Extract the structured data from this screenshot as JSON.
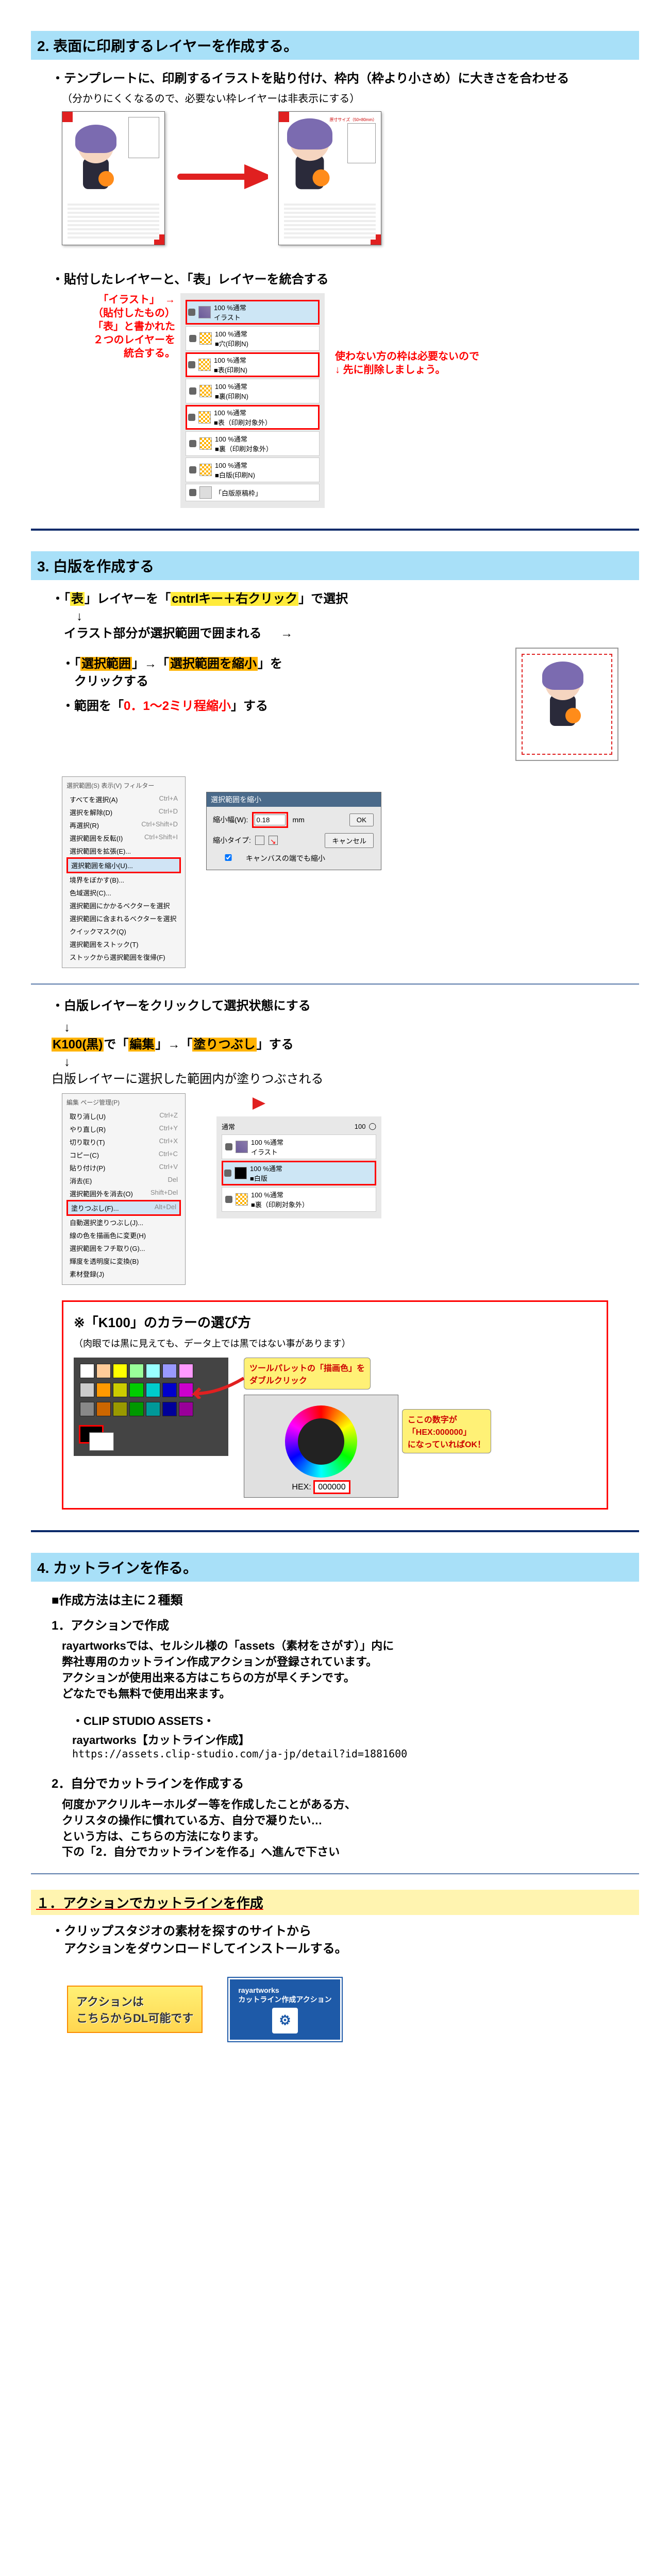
{
  "step2": {
    "header": "2. 表面に印刷するレイヤーを作成する。",
    "bullet1": "・テンプレートに、印刷するイラストを貼り付け、枠内（枠より小さめ）に大きさを合わせる",
    "note1": "（分かりにくくなるので、必要ない枠レイヤーは非表示にする）",
    "bullet2": "・貼付したレイヤーと、「表」レイヤーを統合する",
    "annot_left_1": "「イラスト」",
    "annot_left_2": "（貼付したもの）",
    "annot_left_3": "「表」と書かれた",
    "annot_left_4": "２つのレイヤーを",
    "annot_left_5": "統合する。",
    "annot_right_1": "使わない方の枠は必要ないので",
    "annot_right_2": "先に削除しましょう。",
    "layers": {
      "item1": "100 %通常\nイラスト",
      "item2": "100 %通常\n■穴(印刷N)",
      "item3": "100 %通常\n■表(印刷N)",
      "item4": "100 %通常\n■裏(印刷N)",
      "item5": "100 %通常\n■表（印刷対象外）",
      "item6": "100 %通常\n■裏（印刷対象外）",
      "item7": "100 %通常\n■白版(印刷N)",
      "item8": "「白版原稿枠」"
    }
  },
  "step3": {
    "header": "3. 白版を作成する",
    "bullet1a": "・「",
    "bullet1b": "表",
    "bullet1c": "」レイヤーを「",
    "bullet1d": "cntrlキー＋右クリック",
    "bullet1e": "」で選択",
    "bullet1f": "↓",
    "bullet1g": "イラスト部分が選択範囲で囲まれる",
    "bullet2": "・「",
    "bullet2a": "選択範囲",
    "bullet2b": "」→「",
    "bullet2c": "選択範囲を縮小",
    "bullet2d": "」を",
    "bullet2e": "クリックする",
    "bullet3a": "・範囲を「",
    "bullet3b": "0．1～2ミリ程縮小",
    "bullet3c": "」する",
    "menu": {
      "header": "選択範囲(S)  表示(V)  フィルター",
      "items": [
        {
          "l": "すべてを選択(A)",
          "r": "Ctrl+A"
        },
        {
          "l": "選択を解除(D)",
          "r": "Ctrl+D"
        },
        {
          "l": "再選択(R)",
          "r": "Ctrl+Shift+D"
        },
        {
          "l": "選択範囲を反転(I)",
          "r": "Ctrl+Shift+I"
        },
        {
          "l": "選択範囲を拡張(E)...",
          "r": ""
        },
        {
          "l": "選択範囲を縮小(U)...",
          "r": ""
        },
        {
          "l": "境界をぼかす(B)...",
          "r": ""
        },
        {
          "l": "色域選択(C)...",
          "r": ""
        },
        {
          "l": "選択範囲にかかるベクターを選択",
          "r": ""
        },
        {
          "l": "選択範囲に含まれるベクターを選択",
          "r": ""
        },
        {
          "l": "クイックマスク(Q)",
          "r": ""
        },
        {
          "l": "選択範囲をストック(T)",
          "r": ""
        },
        {
          "l": "ストックから選択範囲を復帰(F)",
          "r": ""
        }
      ]
    },
    "dialog": {
      "title": "選択範囲を縮小",
      "label1": "縮小幅(W):",
      "value1": "0.18",
      "unit1": "mm",
      "label2": "縮小タイプ:",
      "check1": "キャンバスの端でも縮小",
      "ok": "OK",
      "cancel": "キャンセル"
    },
    "bullet4": "・白版レイヤーをクリックして選択状態にする",
    "bullet5a": "↓",
    "bullet5b": "K100(黒)",
    "bullet5c": "で「",
    "bullet5d": "編集",
    "bullet5e": "」→「",
    "bullet5f": "塗りつぶし",
    "bullet5g": "」する",
    "bullet5h": "↓",
    "bullet6": "白版レイヤーに選択した範囲内が塗りつぶされる",
    "menu2": {
      "header": "編集  ページ管理(P)",
      "items": [
        {
          "l": "取り消し(U)",
          "r": "Ctrl+Z"
        },
        {
          "l": "やり直し(R)",
          "r": "Ctrl+Y"
        },
        {
          "l": "切り取り(T)",
          "r": "Ctrl+X"
        },
        {
          "l": "コピー(C)",
          "r": "Ctrl+C"
        },
        {
          "l": "貼り付け(P)",
          "r": "Ctrl+V"
        },
        {
          "l": "消去(E)",
          "r": "Del"
        },
        {
          "l": "選択範囲外を消去(O)",
          "r": "Shift+Del"
        },
        {
          "l": "塗りつぶし(F)...",
          "r": "Alt+Del"
        },
        {
          "l": "自動選択塗りつぶし(J)...",
          "r": ""
        },
        {
          "l": "線の色を描画色に変更(H)",
          "r": ""
        },
        {
          "l": "選択範囲をフチ取り(G)...",
          "r": ""
        },
        {
          "l": "輝度を透明度に変換(B)",
          "r": ""
        },
        {
          "l": "素材登録(J)",
          "r": ""
        }
      ]
    },
    "layer_panel2": {
      "mode": "通常",
      "opacity": "100",
      "item1": "100 %通常\nイラスト",
      "item2": "100 %通常\n■白版",
      "item3": "100 %通常\n■裏（印刷対象外）"
    },
    "info": {
      "title": "※「K100」のカラーの選び方",
      "sub": "（肉眼では黒に見えても、データ上では黒ではない事があります）",
      "callout1": "ツールパレットの「描画色」を\nダブルクリック",
      "callout2a": "ここの数字が",
      "callout2b": "「HEX:000000」",
      "callout2c": "になっていればOK！",
      "hex_label": "HEX:",
      "hex_value": "000000"
    }
  },
  "step4": {
    "header": "4. カットラインを作る。",
    "intro": "■作成方法は主に２種類",
    "method1_title": "1．アクションで作成",
    "method1_body1": "rayartworksでは、セルシル様の「assets（素材をさがす）」内に",
    "method1_body2": "弊社専用のカットライン作成アクションが登録されています。",
    "method1_body3": "アクションが使用出来る方はこちらの方が早くチンです。",
    "method1_body4": "どなたでも無料で使用出来ます。",
    "asset_label": "・CLIP STUDIO ASSETS・",
    "asset_name": "rayartworks【カットライン作成】",
    "asset_url": "https://assets.clip-studio.com/ja-jp/detail?id=1881600",
    "method2_title": "2．自分でカットラインを作成する",
    "method2_body1": "何度かアクリルキーホルダー等を作成したことがある方、",
    "method2_body2": "クリスタの操作に慣れている方、自分で凝りたい…",
    "method2_body3": "という方は、こちらの方法になります。",
    "method2_body4": "下の「2．自分でカットラインを作る」へ進んで下さい",
    "section1_header": "１．アクションでカットラインを作成",
    "section1_bullet1": "・クリップスタジオの素材を探すのサイトから",
    "section1_bullet2": "アクションをダウンロードしてインストールする。",
    "badge1_l1": "アクションは",
    "badge1_l2": "こちらからDL可能です",
    "badge2_l1": "rayartworks",
    "badge2_l2": "カットライン作成アクション"
  }
}
